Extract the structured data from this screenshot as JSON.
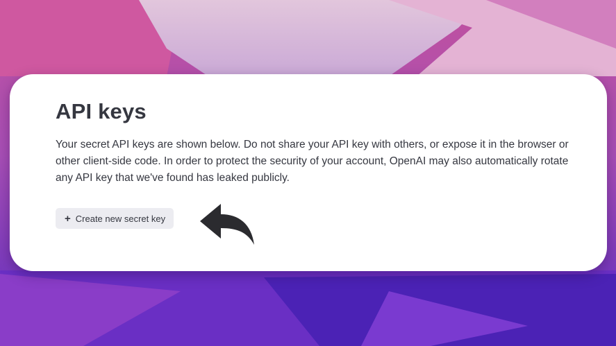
{
  "api_keys": {
    "title": "API keys",
    "description": "Your secret API keys are shown below. Do not share your API key with others, or expose it in the browser or other client-side code. In order to protect the security of your account, OpenAI may also automatically rotate any API key that we've found has leaked publicly.",
    "create_button": {
      "icon": "plus-icon",
      "label": "Create new secret key"
    }
  },
  "annotation": {
    "icon": "curved-arrow-icon",
    "color": "#2b2b2f"
  },
  "colors": {
    "card_background": "#ffffff",
    "text": "#353740",
    "button_background": "#ececf1"
  }
}
